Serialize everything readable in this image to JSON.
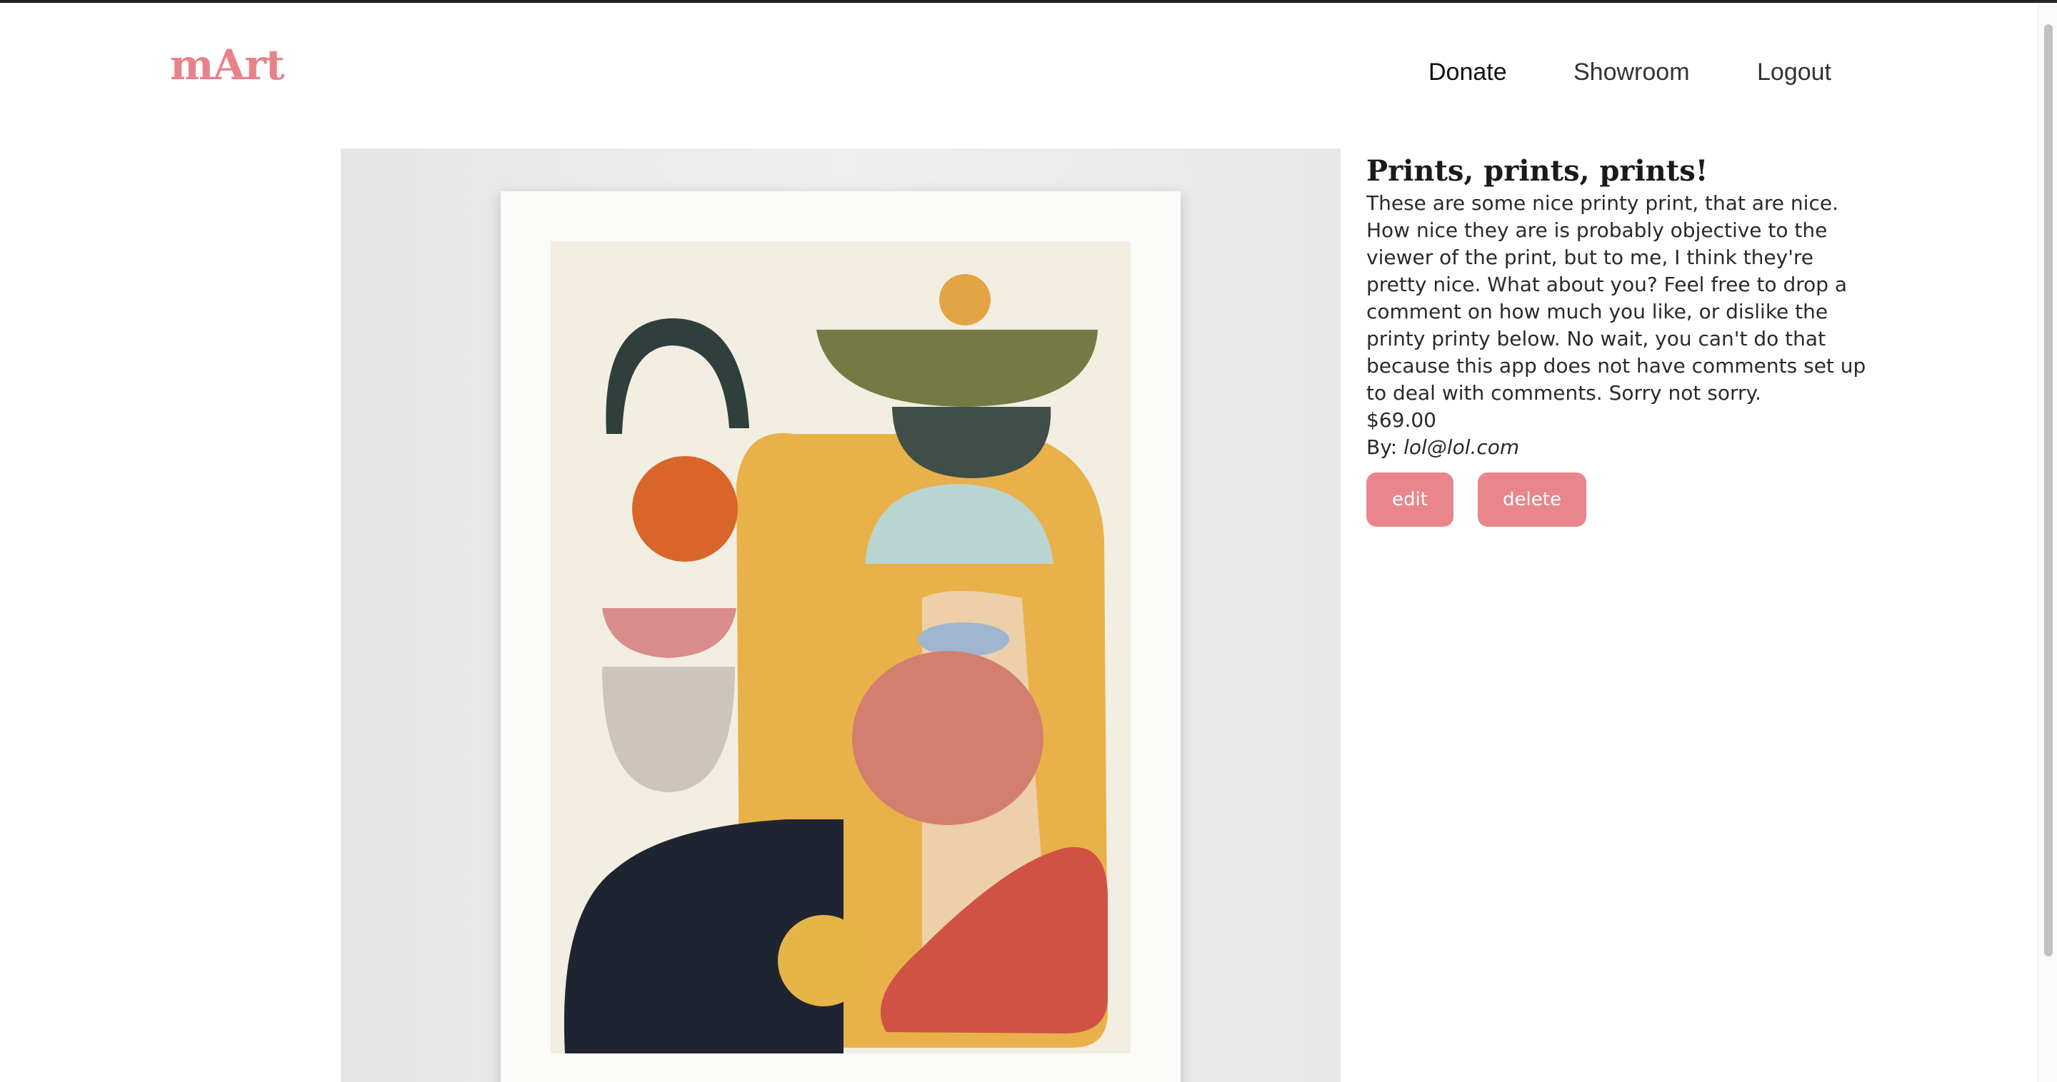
{
  "header": {
    "brand": "mArt",
    "nav": {
      "donate": "Donate",
      "showroom": "Showroom",
      "logout": "Logout"
    }
  },
  "artwork": {
    "title": "Prints, prints, prints!",
    "description": "These are some nice printy print, that are nice. How nice they are is probably objective to the viewer of the print, but to me, I think they're pretty nice. What about you? Feel free to drop a comment on how much you like, or dislike the printy printy below. No wait, you can't do that because this app does not have comments set up to deal with comments. Sorry not sorry.",
    "price": "$69.00",
    "by_label": "By:",
    "author": "lol@lol.com",
    "actions": {
      "edit": "edit",
      "delete": "delete"
    }
  },
  "colors": {
    "brand": "#e8828a",
    "button": "#e8868c"
  }
}
